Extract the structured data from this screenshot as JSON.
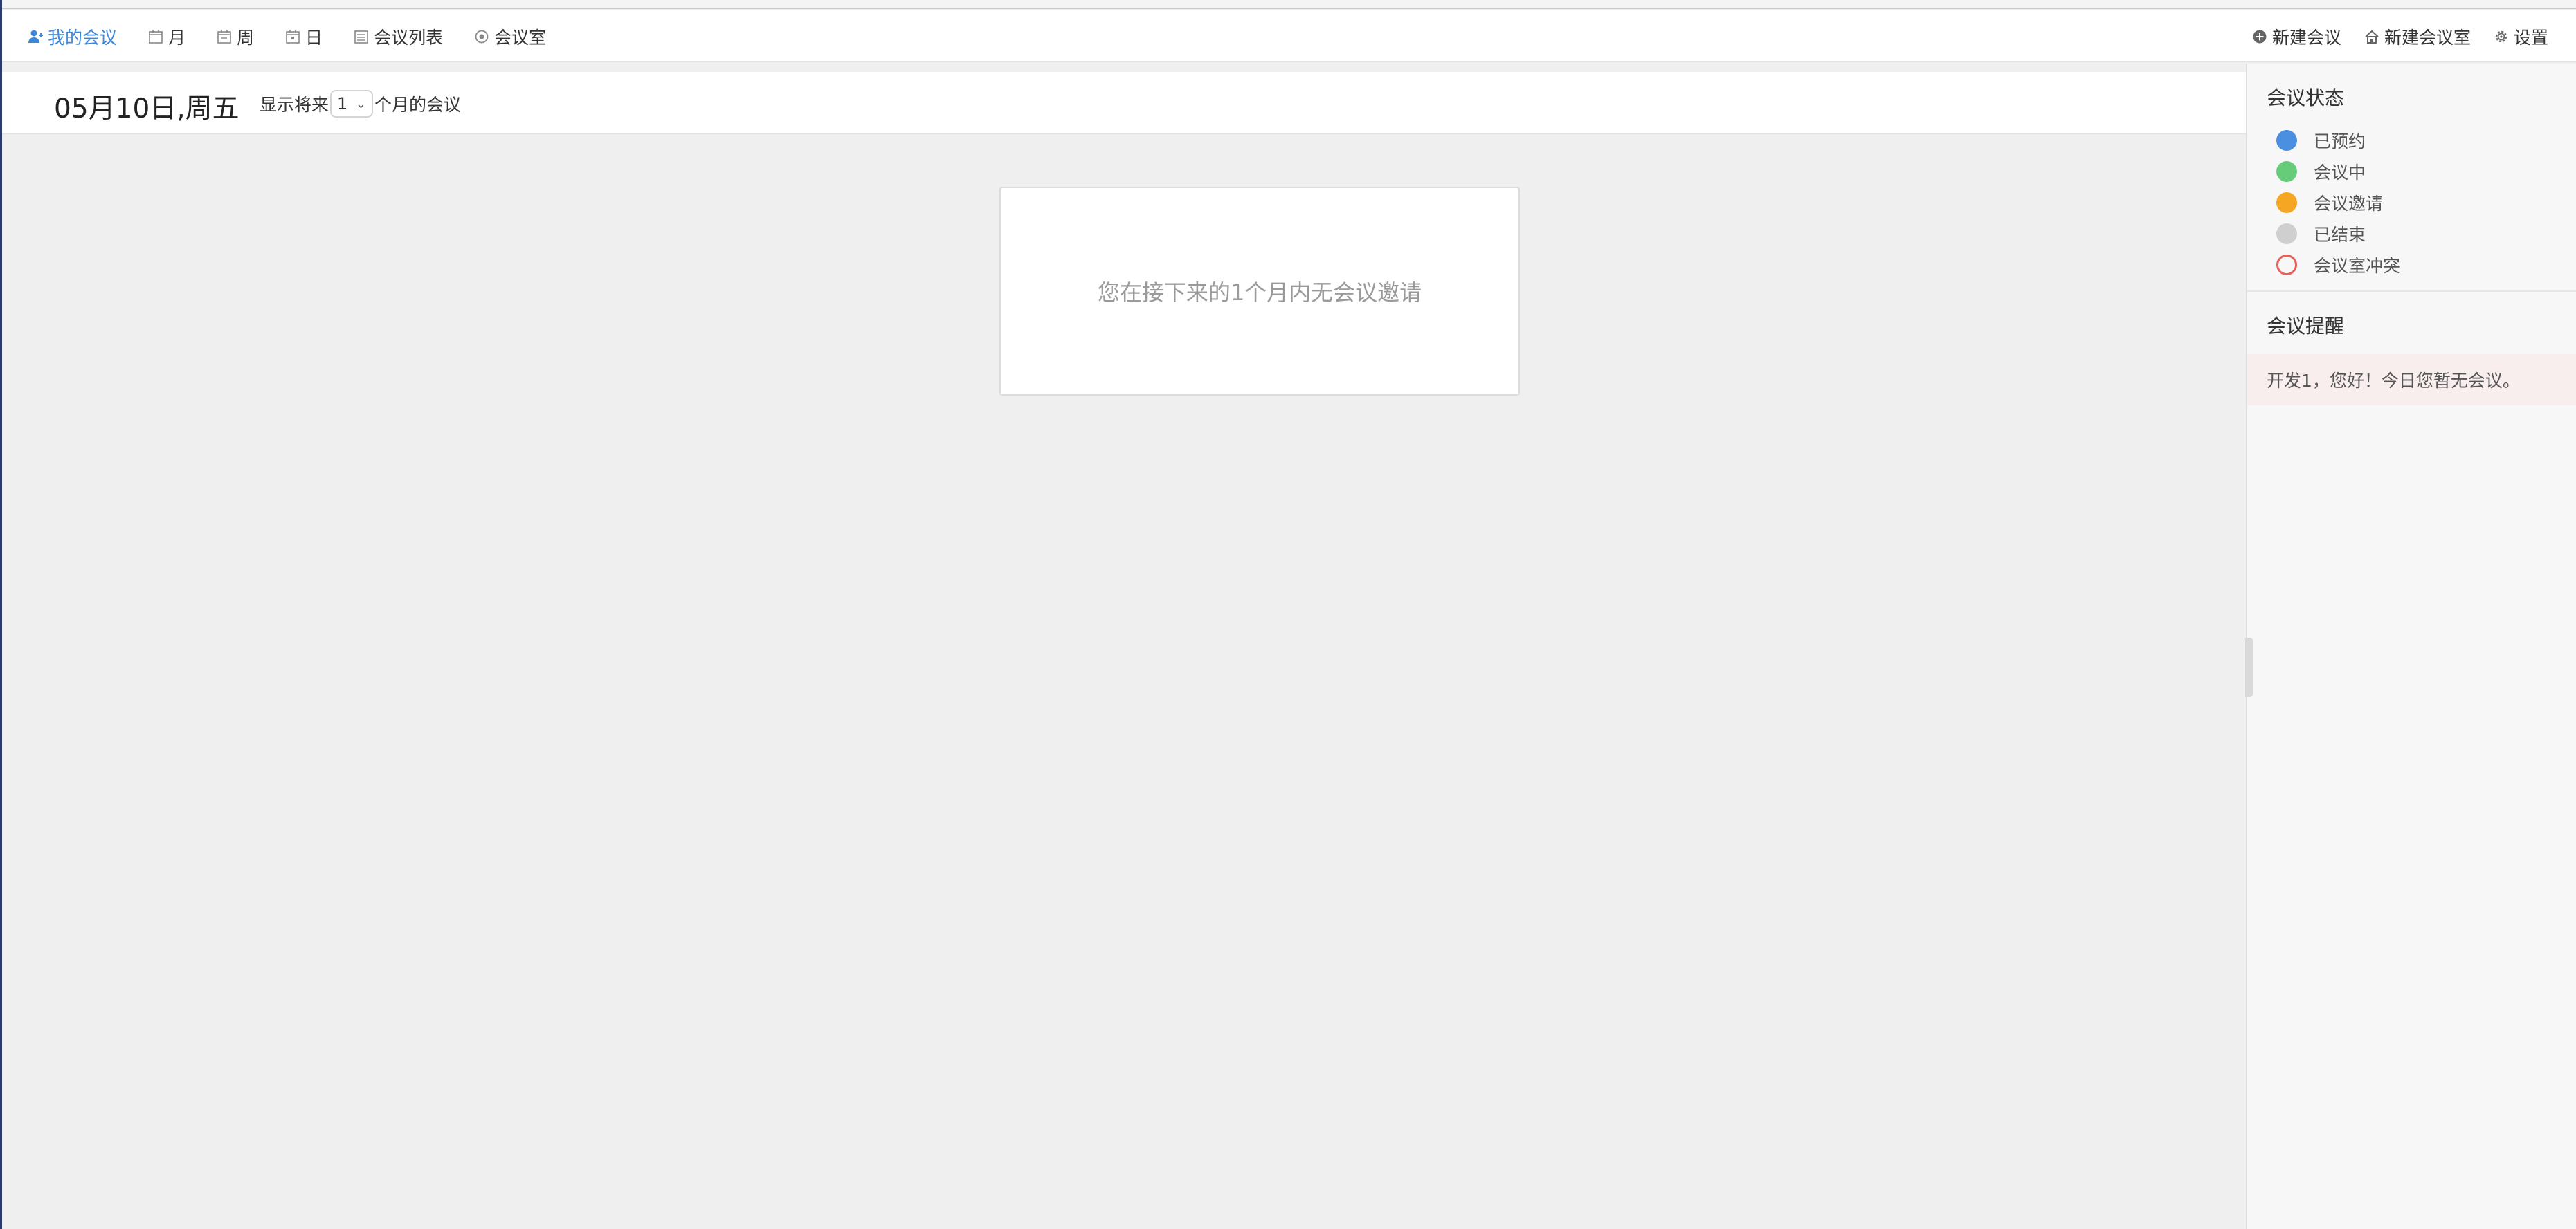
{
  "nav": {
    "left": [
      {
        "label": "我的会议",
        "icon": "user-icon",
        "active": true
      },
      {
        "label": "月",
        "icon": "calendar-month-icon"
      },
      {
        "label": "周",
        "icon": "calendar-week-icon"
      },
      {
        "label": "日",
        "icon": "calendar-day-icon"
      },
      {
        "label": "会议列表",
        "icon": "list-icon"
      },
      {
        "label": "会议室",
        "icon": "room-icon"
      }
    ],
    "right": [
      {
        "label": "新建会议",
        "icon": "plus-circle-icon"
      },
      {
        "label": "新建会议室",
        "icon": "home-icon"
      },
      {
        "label": "设置",
        "icon": "gear-icon"
      }
    ]
  },
  "header": {
    "date_title": "05月10日,周五",
    "range_prefix": "显示将来",
    "range_value": "1",
    "range_suffix": "个月的会议"
  },
  "main": {
    "empty_message": "您在接下来的1个月内无会议邀请"
  },
  "sidebar": {
    "status_title": "会议状态",
    "statuses": [
      {
        "label": "已预约",
        "color": "#4a8fe0",
        "hollow": false
      },
      {
        "label": "会议中",
        "color": "#66cc7a",
        "hollow": false
      },
      {
        "label": "会议邀请",
        "color": "#f5a623",
        "hollow": false
      },
      {
        "label": "已结束",
        "color": "#cfcfcf",
        "hollow": false
      },
      {
        "label": "会议室冲突",
        "color": "#e8605a",
        "hollow": true
      }
    ],
    "remind_title": "会议提醒",
    "remind_text": "开发1，您好！今日您暂无会议。"
  },
  "colors": {
    "accent": "#3b86d9",
    "background": "#efefef"
  }
}
